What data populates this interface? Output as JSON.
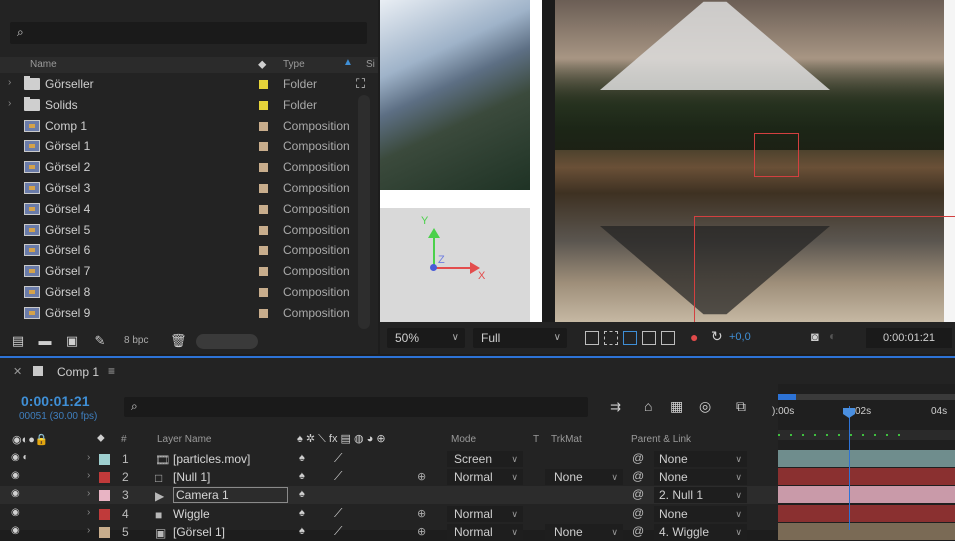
{
  "project": {
    "columns": {
      "name": "Name",
      "type": "Type",
      "size": "Si"
    },
    "items": [
      {
        "name": "Görseller",
        "type": "Folder",
        "kind": "folder",
        "has_arrow": true,
        "swatch": "#e6d43a"
      },
      {
        "name": "Solids",
        "type": "Folder",
        "kind": "folder",
        "has_arrow": true,
        "swatch": "#e6d43a"
      },
      {
        "name": "Comp 1",
        "type": "Composition",
        "kind": "comp",
        "has_arrow": false,
        "swatch": "#c8ad8c"
      },
      {
        "name": "Görsel 1",
        "type": "Composition",
        "kind": "comp",
        "has_arrow": false,
        "swatch": "#c8ad8c"
      },
      {
        "name": "Görsel 2",
        "type": "Composition",
        "kind": "comp",
        "has_arrow": false,
        "swatch": "#c8ad8c"
      },
      {
        "name": "Görsel 3",
        "type": "Composition",
        "kind": "comp",
        "has_arrow": false,
        "swatch": "#c8ad8c"
      },
      {
        "name": "Görsel 4",
        "type": "Composition",
        "kind": "comp",
        "has_arrow": false,
        "swatch": "#c8ad8c"
      },
      {
        "name": "Görsel 5",
        "type": "Composition",
        "kind": "comp",
        "has_arrow": false,
        "swatch": "#c8ad8c"
      },
      {
        "name": "Görsel 6",
        "type": "Composition",
        "kind": "comp",
        "has_arrow": false,
        "swatch": "#c8ad8c"
      },
      {
        "name": "Görsel 7",
        "type": "Composition",
        "kind": "comp",
        "has_arrow": false,
        "swatch": "#c8ad8c"
      },
      {
        "name": "Görsel 8",
        "type": "Composition",
        "kind": "comp",
        "has_arrow": false,
        "swatch": "#c8ad8c"
      },
      {
        "name": "Görsel 9",
        "type": "Composition",
        "kind": "comp",
        "has_arrow": false,
        "swatch": "#c8ad8c"
      }
    ],
    "footer": {
      "bpc": "8 bpc"
    }
  },
  "viewer": {
    "axis_y": "Y",
    "axis_z": "Z",
    "axis_x": "X",
    "zoom": "50%",
    "resolution": "Full",
    "exposure": "+0,0",
    "timecode": "0:00:01:21"
  },
  "timeline": {
    "tab": "Comp 1",
    "menu_icon": "≡",
    "time": "0:00:01:21",
    "frames": "00051 (30.00 fps)",
    "headers": {
      "layer_name": "Layer Name",
      "mode": "Mode",
      "t": "T",
      "trkmat": "TrkMat",
      "parent": "Parent & Link",
      "hash": "#"
    },
    "ruler": {
      "t0": "):00s",
      "t2": "02s",
      "t4": "04s"
    },
    "layers": [
      {
        "num": "1",
        "name": "[particles.mov]",
        "label_color": "#9ecfcf",
        "icon": "film-icon",
        "mode": "Screen",
        "trkmat": "",
        "parent": "None",
        "bar_color": "#6f8d8d",
        "has_audio": true
      },
      {
        "num": "2",
        "name": "[Null 1]",
        "label_color": "#c03a3a",
        "icon": "null-icon",
        "mode": "Normal",
        "trkmat": "None",
        "parent": "None",
        "bar_color": "#8a3030",
        "has_audio": false
      },
      {
        "num": "3",
        "name": "Camera 1",
        "label_color": "#e8b4c4",
        "icon": "camera-icon",
        "mode": "",
        "trkmat": "",
        "parent": "2. Null 1",
        "bar_color": "#c99aa9",
        "has_audio": false
      },
      {
        "num": "4",
        "name": "Wiggle",
        "label_color": "#c03a3a",
        "icon": "solid-icon",
        "mode": "Normal",
        "trkmat": "",
        "parent": "None",
        "bar_color": "#8a3030",
        "has_audio": false
      },
      {
        "num": "5",
        "name": "[Görsel 1]",
        "label_color": "#c8ad8c",
        "icon": "comp-icon",
        "mode": "Normal",
        "trkmat": "None",
        "parent": "4. Wiggle",
        "bar_color": "#7a6a55",
        "has_audio": false
      }
    ]
  },
  "colors": {
    "accent": "#2d73d6",
    "folder_swatch": "#e6d43a",
    "comp_swatch": "#c8ad8c"
  }
}
